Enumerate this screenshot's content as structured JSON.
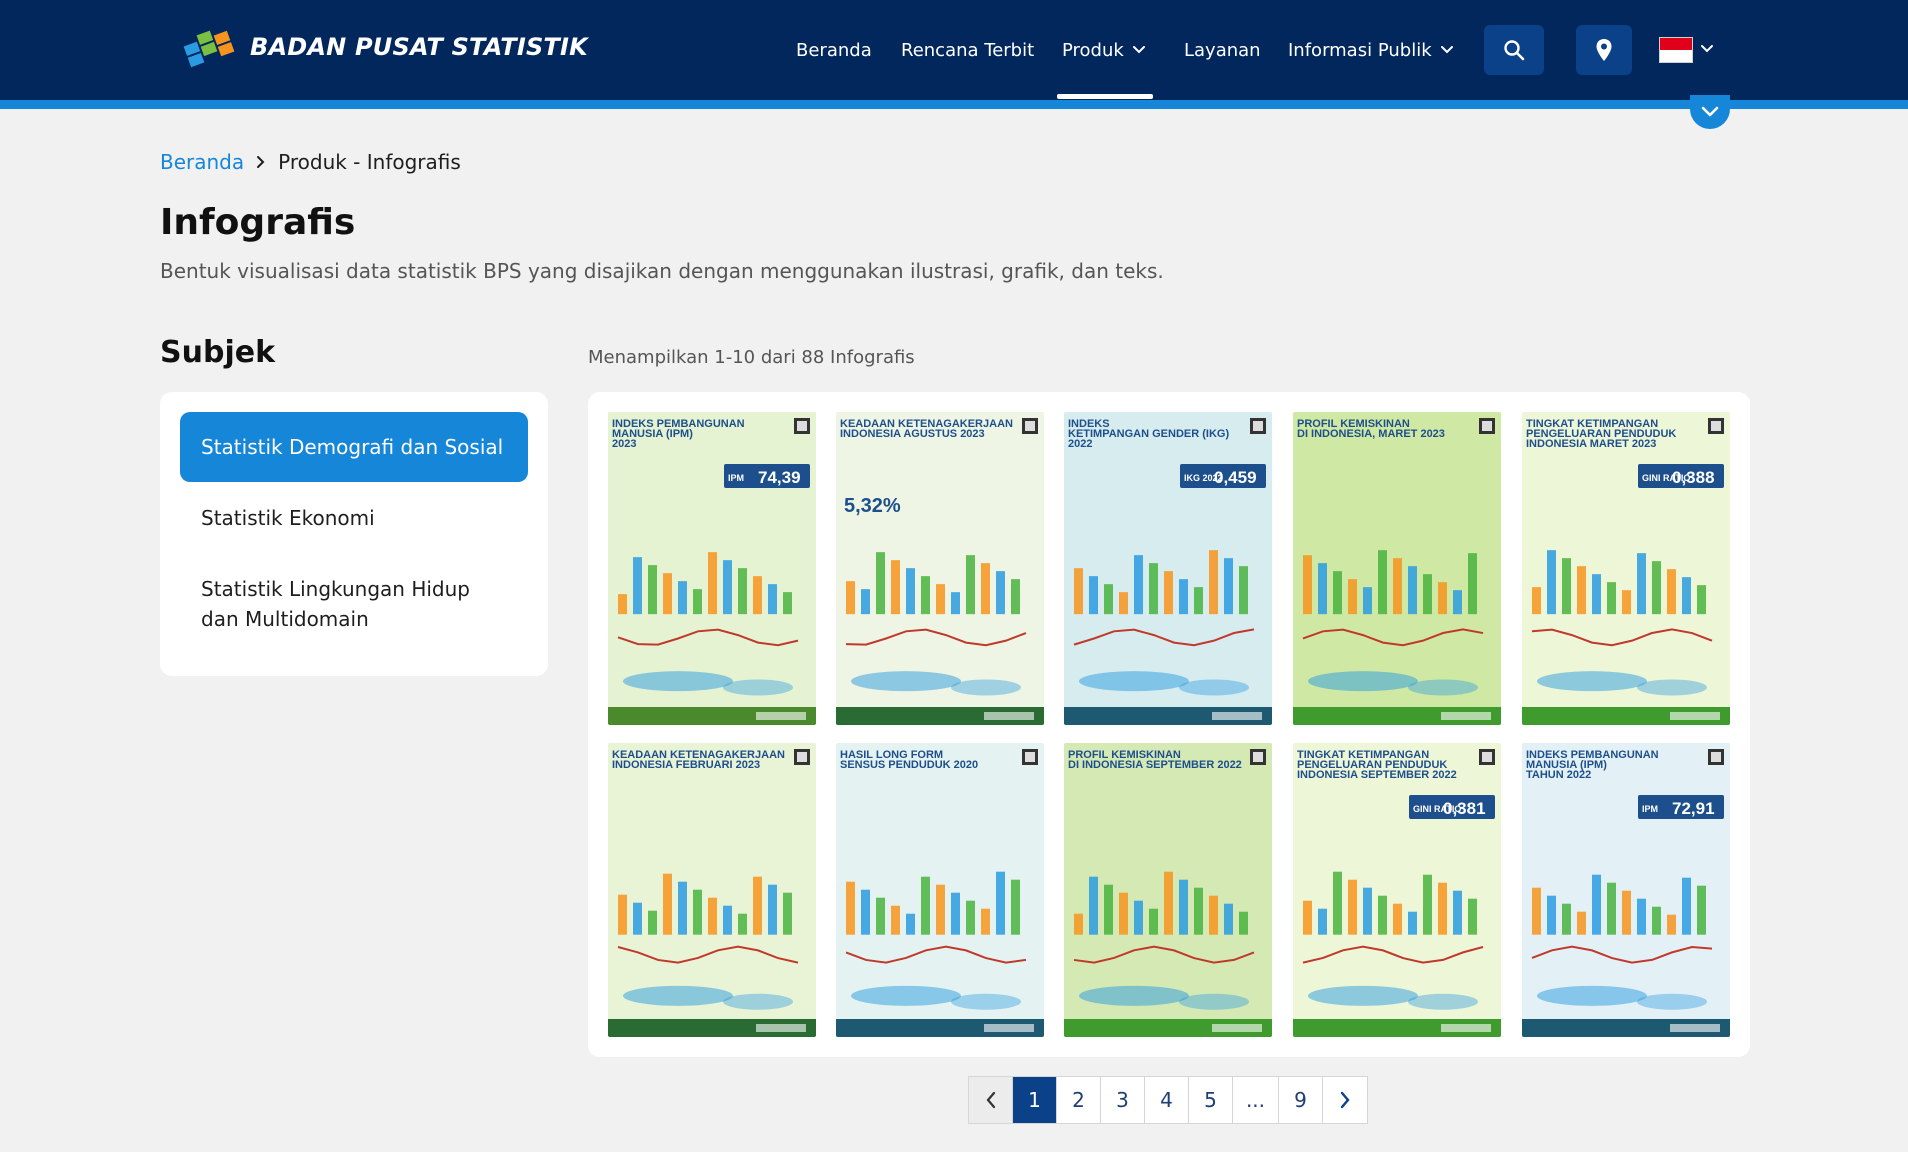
{
  "header": {
    "brand": "BADAN PUSAT STATISTIK",
    "nav": [
      {
        "label": "Beranda",
        "dropdown": false
      },
      {
        "label": "Rencana Terbit",
        "dropdown": false
      },
      {
        "label": "Produk",
        "dropdown": true,
        "active": true
      },
      {
        "label": "Layanan",
        "dropdown": false
      },
      {
        "label": "Informasi Publik",
        "dropdown": true
      }
    ],
    "icons": [
      "search-icon",
      "location-pin-icon",
      "indonesia-flag-icon",
      "chevron-down-icon"
    ]
  },
  "breadcrumb": {
    "home": "Beranda",
    "current": "Produk - Infografis"
  },
  "page": {
    "title": "Infografis",
    "description": "Bentuk visualisasi data statistik BPS yang disajikan dengan menggunakan ilustrasi, grafik, dan teks."
  },
  "sidebar": {
    "title": "Subjek",
    "items": [
      {
        "label": "Statistik Demografi dan Sosial",
        "active": true
      },
      {
        "label": "Statistik Ekonomi",
        "active": false
      },
      {
        "label": "Statistik Lingkungan Hidup dan Multidomain",
        "active": false
      }
    ]
  },
  "results": {
    "summary": "Menampilkan 1-10 dari 88 Infografis"
  },
  "infographics": [
    {
      "title_lines": [
        "INDEKS PEMBANGUNAN",
        "MANUSIA (IPM)",
        "2023"
      ],
      "big_value": "74,39",
      "value_prefix": "IPM",
      "bg": "#e6f3d2",
      "footer": "#4a8a2c"
    },
    {
      "title_lines": [
        "KEADAAN KETENAGAKERJAAN",
        "INDONESIA AGUSTUS 2023"
      ],
      "big_value": "5,32%",
      "value_prefix": "",
      "bg": "#eef5e4",
      "footer": "#2a6b33"
    },
    {
      "title_lines": [
        "INDEKS",
        "KETIMPANGAN GENDER (IKG)",
        "2022"
      ],
      "big_value": "0,459",
      "value_prefix": "IKG 2022",
      "bg": "#d7ecef",
      "footer": "#1d5a72"
    },
    {
      "title_lines": [
        "PROFIL KEMISKINAN",
        "DI INDONESIA, MARET 2023"
      ],
      "big_value": "",
      "value_prefix": "",
      "bg": "#cfe8a4",
      "footer": "#3f9b2e"
    },
    {
      "title_lines": [
        "TINGKAT KETIMPANGAN",
        "PENGELUARAN PENDUDUK",
        "INDONESIA MARET 2023"
      ],
      "big_value": "0,388",
      "value_prefix": "GINI RATIO",
      "bg": "#eef6d8",
      "footer": "#3f9b2e"
    },
    {
      "title_lines": [
        "KEADAAN KETENAGAKERJAAN",
        "INDONESIA FEBRUARI 2023"
      ],
      "big_value": "",
      "value_prefix": "",
      "bg": "#e9f3d6",
      "footer": "#2a6b33"
    },
    {
      "title_lines": [
        "HASIL LONG FORM",
        "SENSUS PENDUDUK 2020"
      ],
      "big_value": "",
      "value_prefix": "",
      "bg": "#e4f3f1",
      "footer": "#1d5a72"
    },
    {
      "title_lines": [
        "PROFIL KEMISKINAN",
        "DI INDONESIA SEPTEMBER 2022"
      ],
      "big_value": "",
      "value_prefix": "",
      "bg": "#d5e9b4",
      "footer": "#3f9b2e"
    },
    {
      "title_lines": [
        "TINGKAT KETIMPANGAN",
        "PENGELUARAN PENDUDUK",
        "INDONESIA SEPTEMBER 2022"
      ],
      "big_value": "0,381",
      "value_prefix": "GINI RATIO",
      "bg": "#eef6d8",
      "footer": "#3f9b2e"
    },
    {
      "title_lines": [
        "INDEKS PEMBANGUNAN",
        "MANUSIA (IPM)",
        "TAHUN 2022"
      ],
      "big_value": "72,91",
      "value_prefix": "IPM",
      "bg": "#e3f1f6",
      "footer": "#1d5a72"
    }
  ],
  "pagination": {
    "pages": [
      "1",
      "2",
      "3",
      "4",
      "5",
      "...",
      "9"
    ],
    "current": "1"
  },
  "colors": {
    "header_bg": "#02275d",
    "accent": "#1686d9",
    "active_page": "#0a4189"
  }
}
